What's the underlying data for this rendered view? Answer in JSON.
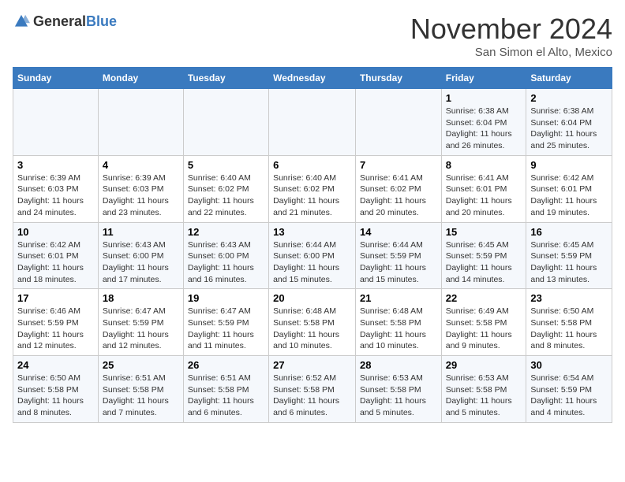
{
  "header": {
    "logo_general": "General",
    "logo_blue": "Blue",
    "month": "November 2024",
    "location": "San Simon el Alto, Mexico"
  },
  "days_of_week": [
    "Sunday",
    "Monday",
    "Tuesday",
    "Wednesday",
    "Thursday",
    "Friday",
    "Saturday"
  ],
  "weeks": [
    [
      {
        "day": "",
        "sunrise": "",
        "sunset": "",
        "daylight": ""
      },
      {
        "day": "",
        "sunrise": "",
        "sunset": "",
        "daylight": ""
      },
      {
        "day": "",
        "sunrise": "",
        "sunset": "",
        "daylight": ""
      },
      {
        "day": "",
        "sunrise": "",
        "sunset": "",
        "daylight": ""
      },
      {
        "day": "",
        "sunrise": "",
        "sunset": "",
        "daylight": ""
      },
      {
        "day": "1",
        "sunrise": "Sunrise: 6:38 AM",
        "sunset": "Sunset: 6:04 PM",
        "daylight": "Daylight: 11 hours and 26 minutes."
      },
      {
        "day": "2",
        "sunrise": "Sunrise: 6:38 AM",
        "sunset": "Sunset: 6:04 PM",
        "daylight": "Daylight: 11 hours and 25 minutes."
      }
    ],
    [
      {
        "day": "3",
        "sunrise": "Sunrise: 6:39 AM",
        "sunset": "Sunset: 6:03 PM",
        "daylight": "Daylight: 11 hours and 24 minutes."
      },
      {
        "day": "4",
        "sunrise": "Sunrise: 6:39 AM",
        "sunset": "Sunset: 6:03 PM",
        "daylight": "Daylight: 11 hours and 23 minutes."
      },
      {
        "day": "5",
        "sunrise": "Sunrise: 6:40 AM",
        "sunset": "Sunset: 6:02 PM",
        "daylight": "Daylight: 11 hours and 22 minutes."
      },
      {
        "day": "6",
        "sunrise": "Sunrise: 6:40 AM",
        "sunset": "Sunset: 6:02 PM",
        "daylight": "Daylight: 11 hours and 21 minutes."
      },
      {
        "day": "7",
        "sunrise": "Sunrise: 6:41 AM",
        "sunset": "Sunset: 6:02 PM",
        "daylight": "Daylight: 11 hours and 20 minutes."
      },
      {
        "day": "8",
        "sunrise": "Sunrise: 6:41 AM",
        "sunset": "Sunset: 6:01 PM",
        "daylight": "Daylight: 11 hours and 20 minutes."
      },
      {
        "day": "9",
        "sunrise": "Sunrise: 6:42 AM",
        "sunset": "Sunset: 6:01 PM",
        "daylight": "Daylight: 11 hours and 19 minutes."
      }
    ],
    [
      {
        "day": "10",
        "sunrise": "Sunrise: 6:42 AM",
        "sunset": "Sunset: 6:01 PM",
        "daylight": "Daylight: 11 hours and 18 minutes."
      },
      {
        "day": "11",
        "sunrise": "Sunrise: 6:43 AM",
        "sunset": "Sunset: 6:00 PM",
        "daylight": "Daylight: 11 hours and 17 minutes."
      },
      {
        "day": "12",
        "sunrise": "Sunrise: 6:43 AM",
        "sunset": "Sunset: 6:00 PM",
        "daylight": "Daylight: 11 hours and 16 minutes."
      },
      {
        "day": "13",
        "sunrise": "Sunrise: 6:44 AM",
        "sunset": "Sunset: 6:00 PM",
        "daylight": "Daylight: 11 hours and 15 minutes."
      },
      {
        "day": "14",
        "sunrise": "Sunrise: 6:44 AM",
        "sunset": "Sunset: 5:59 PM",
        "daylight": "Daylight: 11 hours and 15 minutes."
      },
      {
        "day": "15",
        "sunrise": "Sunrise: 6:45 AM",
        "sunset": "Sunset: 5:59 PM",
        "daylight": "Daylight: 11 hours and 14 minutes."
      },
      {
        "day": "16",
        "sunrise": "Sunrise: 6:45 AM",
        "sunset": "Sunset: 5:59 PM",
        "daylight": "Daylight: 11 hours and 13 minutes."
      }
    ],
    [
      {
        "day": "17",
        "sunrise": "Sunrise: 6:46 AM",
        "sunset": "Sunset: 5:59 PM",
        "daylight": "Daylight: 11 hours and 12 minutes."
      },
      {
        "day": "18",
        "sunrise": "Sunrise: 6:47 AM",
        "sunset": "Sunset: 5:59 PM",
        "daylight": "Daylight: 11 hours and 12 minutes."
      },
      {
        "day": "19",
        "sunrise": "Sunrise: 6:47 AM",
        "sunset": "Sunset: 5:59 PM",
        "daylight": "Daylight: 11 hours and 11 minutes."
      },
      {
        "day": "20",
        "sunrise": "Sunrise: 6:48 AM",
        "sunset": "Sunset: 5:58 PM",
        "daylight": "Daylight: 11 hours and 10 minutes."
      },
      {
        "day": "21",
        "sunrise": "Sunrise: 6:48 AM",
        "sunset": "Sunset: 5:58 PM",
        "daylight": "Daylight: 11 hours and 10 minutes."
      },
      {
        "day": "22",
        "sunrise": "Sunrise: 6:49 AM",
        "sunset": "Sunset: 5:58 PM",
        "daylight": "Daylight: 11 hours and 9 minutes."
      },
      {
        "day": "23",
        "sunrise": "Sunrise: 6:50 AM",
        "sunset": "Sunset: 5:58 PM",
        "daylight": "Daylight: 11 hours and 8 minutes."
      }
    ],
    [
      {
        "day": "24",
        "sunrise": "Sunrise: 6:50 AM",
        "sunset": "Sunset: 5:58 PM",
        "daylight": "Daylight: 11 hours and 8 minutes."
      },
      {
        "day": "25",
        "sunrise": "Sunrise: 6:51 AM",
        "sunset": "Sunset: 5:58 PM",
        "daylight": "Daylight: 11 hours and 7 minutes."
      },
      {
        "day": "26",
        "sunrise": "Sunrise: 6:51 AM",
        "sunset": "Sunset: 5:58 PM",
        "daylight": "Daylight: 11 hours and 6 minutes."
      },
      {
        "day": "27",
        "sunrise": "Sunrise: 6:52 AM",
        "sunset": "Sunset: 5:58 PM",
        "daylight": "Daylight: 11 hours and 6 minutes."
      },
      {
        "day": "28",
        "sunrise": "Sunrise: 6:53 AM",
        "sunset": "Sunset: 5:58 PM",
        "daylight": "Daylight: 11 hours and 5 minutes."
      },
      {
        "day": "29",
        "sunrise": "Sunrise: 6:53 AM",
        "sunset": "Sunset: 5:58 PM",
        "daylight": "Daylight: 11 hours and 5 minutes."
      },
      {
        "day": "30",
        "sunrise": "Sunrise: 6:54 AM",
        "sunset": "Sunset: 5:59 PM",
        "daylight": "Daylight: 11 hours and 4 minutes."
      }
    ]
  ]
}
